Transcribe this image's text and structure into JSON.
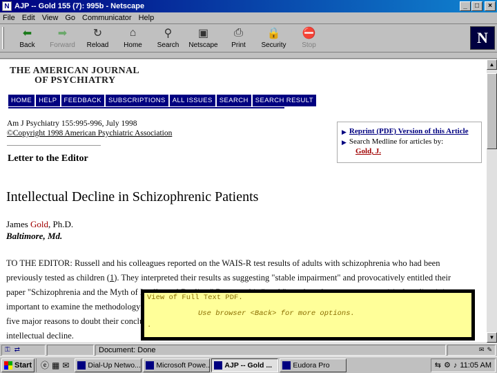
{
  "window": {
    "title": "AJP -- Gold 155 (7): 995b - Netscape"
  },
  "menu": [
    "File",
    "Edit",
    "View",
    "Go",
    "Communicator",
    "Help"
  ],
  "toolbar": [
    {
      "label": "Back",
      "icon": "back-arrow-icon",
      "glyph": "⬅",
      "color": "#1a7a1a",
      "enabled": true
    },
    {
      "label": "Forward",
      "icon": "forward-arrow-icon",
      "glyph": "➡",
      "color": "#6aa86a",
      "enabled": false
    },
    {
      "label": "Reload",
      "icon": "reload-icon",
      "glyph": "↻",
      "color": "#333",
      "enabled": true
    },
    {
      "label": "Home",
      "icon": "home-icon",
      "glyph": "⌂",
      "color": "#333",
      "enabled": true
    },
    {
      "label": "Search",
      "icon": "search-icon",
      "glyph": "⚲",
      "color": "#333",
      "enabled": true
    },
    {
      "label": "Netscape",
      "icon": "netscape-icon",
      "glyph": "▣",
      "color": "#333",
      "enabled": true
    },
    {
      "label": "Print",
      "icon": "print-icon",
      "glyph": "⎙",
      "color": "#333",
      "enabled": true
    },
    {
      "label": "Security",
      "icon": "lock-icon",
      "glyph": "🔒",
      "color": "#333",
      "enabled": true
    },
    {
      "label": "Stop",
      "icon": "stop-icon",
      "glyph": "⛔",
      "color": "#888",
      "enabled": false
    }
  ],
  "logo": {
    "letter": "N"
  },
  "page": {
    "journal_line1": "THE AMERICAN JOURNAL",
    "journal_line2": "OF PSYCHIATRY",
    "nav": [
      "HOME",
      "HELP",
      "FEEDBACK",
      "SUBSCRIPTIONS",
      "ALL ISSUES",
      "SEARCH",
      "SEARCH RESULT"
    ],
    "citation": "Am J Psychiatry 155:995-996, July 1998",
    "copyright": "©Copyright 1998 American Psychiatric Association",
    "section": "Letter to the Editor",
    "title": "Intellectual Decline in Schizophrenic Patients",
    "author_first": "James ",
    "author_last": "Gold",
    "author_suffix": ", Ph.D.",
    "affiliation": "Baltimore, Md.",
    "body": {
      "l1": "TO THE EDITOR: Russell and his colleagues reported on the WAIS-R test results of adults with schizophrenia who had been",
      "l2a": "previously tested as children (",
      "l2ref": "1",
      "l2b": "). They interpreted their results as suggesting \"stable impairment\" and provocatively entitled their",
      "l3": "paper \"Schizophrenia and the Myth of Intellectual Decline.\" Because this \"myth\" was based on numerous empirical studies, it is",
      "l4": "important to examine the methodology and results of this new study carefully. In my view, there are",
      "l5": "five major reasons to doubt their conclusion",
      "l6": "intellectual decline."
    },
    "sidebar": {
      "reprint": "Reprint (PDF) Version of this Article",
      "medline": "Search Medline for articles by:",
      "author_link": "Gold, J."
    }
  },
  "popup": {
    "line1": "View of Full Text PDF.",
    "line2": "Use browser <Back> for more options.",
    "line3": "."
  },
  "status": {
    "text": "Document: Done"
  },
  "taskbar": {
    "start": "Start",
    "tasks": [
      {
        "label": "Dial-Up Netwo...",
        "active": false
      },
      {
        "label": "Microsoft Powe...",
        "active": false
      },
      {
        "label": "AJP -- Gold ...",
        "active": true
      },
      {
        "label": "Eudora Pro",
        "active": false
      }
    ],
    "clock": "11:05 AM"
  }
}
